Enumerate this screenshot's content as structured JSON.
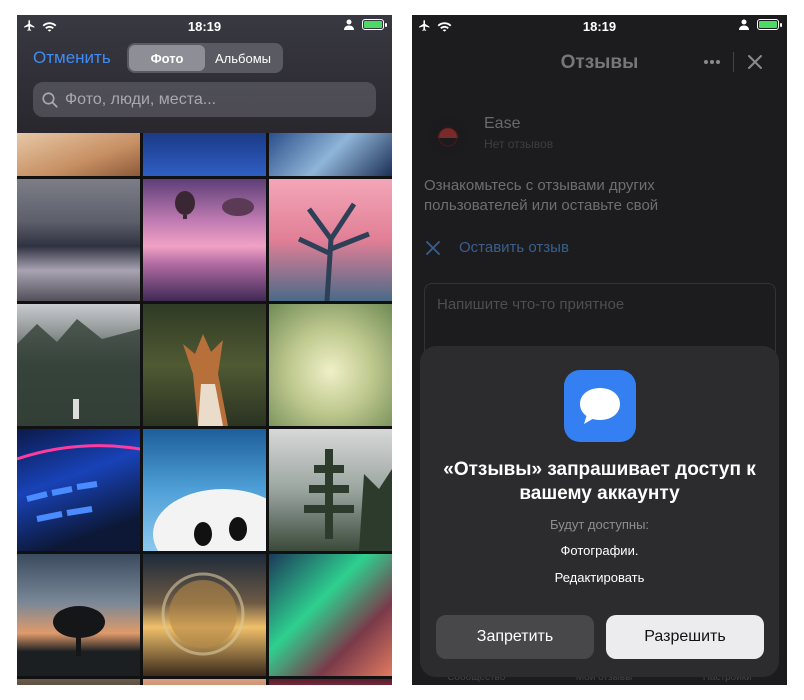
{
  "status_bar": {
    "time": "18:19"
  },
  "photo_picker": {
    "cancel_label": "Отменить",
    "tabs": [
      {
        "label": "Фото",
        "active": true
      },
      {
        "label": "Альбомы",
        "active": false
      }
    ],
    "search_placeholder": "Фото, люди, места..."
  },
  "reviews_app": {
    "title": "Отзывы",
    "app_name": "Ease",
    "app_reviews_count": "Нет отзывов",
    "description": "Ознакомьтесь с отзывами других пользователей или оставьте свой",
    "leave_review_label": "Оставить отзыв",
    "review_placeholder": "Напишите что-то приятное",
    "bottom_tabs": [
      "Сообщество",
      "Мои отзывы",
      "Настройки"
    ]
  },
  "permission_sheet": {
    "title": "«Отзывы» запрашивает доступ к вашему аккаунту",
    "subtitle": "Будут доступны:",
    "permission": "Фотографии.",
    "edit_label": "Редактировать",
    "deny_label": "Запретить",
    "allow_label": "Разрешить"
  },
  "colors": {
    "accent_blue": "#3f8cf3",
    "app_icon_blue": "#3480f3",
    "sheet_bg": "#2c2c2e"
  },
  "icons": [
    "airplane-icon",
    "wifi-icon",
    "person-icon",
    "battery-icon",
    "search-icon",
    "more-icon",
    "close-icon",
    "cross-icon",
    "chat-bubble-icon"
  ]
}
